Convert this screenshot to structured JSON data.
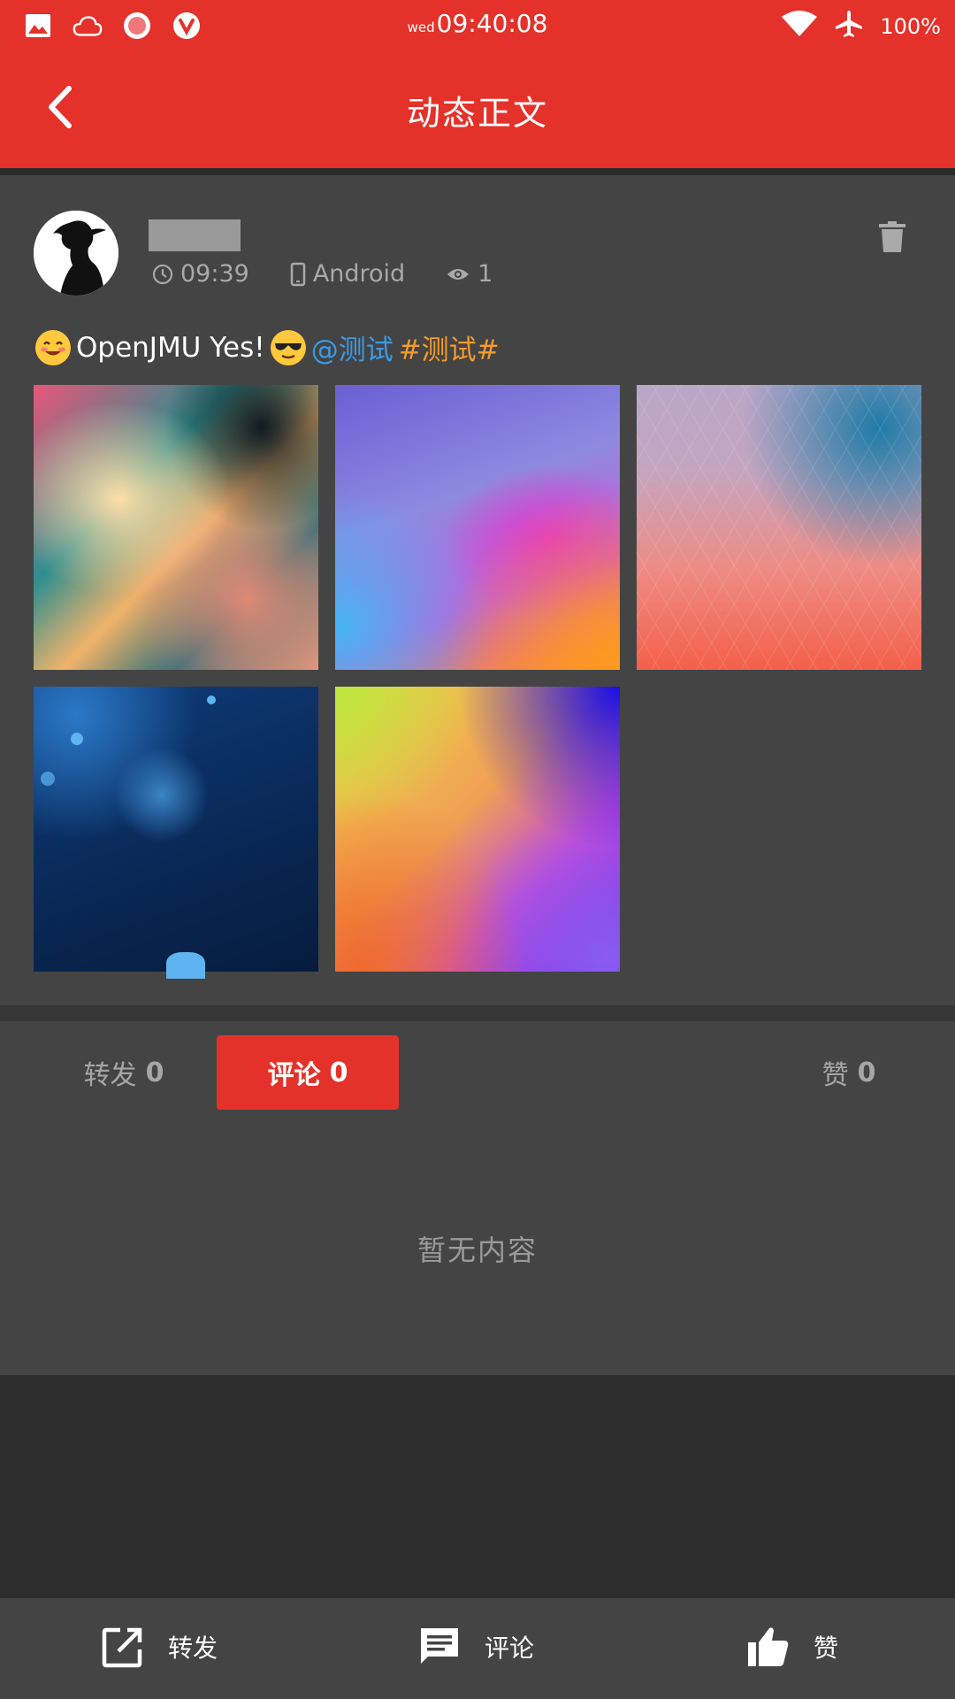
{
  "status_bar": {
    "day": "wed",
    "time": "09:40:08",
    "battery": "100%",
    "icons_left": [
      "image-icon",
      "cloud-icon",
      "record-icon",
      "vivaldi-icon"
    ],
    "icons_right": [
      "wifi-icon",
      "airplane-icon"
    ]
  },
  "app_bar": {
    "title": "动态正文"
  },
  "post": {
    "time": "09:39",
    "device": "Android",
    "views": "1",
    "text_main": "OpenJMU Yes!",
    "mention": "@测试",
    "topic": "#测试#",
    "images": [
      "abstract-swirl",
      "purple-orange-wave",
      "triangle-pattern",
      "blue-bokeh",
      "colorful-gradient"
    ]
  },
  "tabs": {
    "forward_label": "转发",
    "forward_count": "0",
    "comment_label": "评论",
    "comment_count": "0",
    "like_label": "赞",
    "like_count": "0",
    "selected": "comment"
  },
  "comments": {
    "empty_text": "暂无内容"
  },
  "bottom_bar": {
    "forward": "转发",
    "comment": "评论",
    "like": "赞"
  },
  "colors": {
    "accent": "#e4322b",
    "background": "#2d2d2d",
    "card": "#444444",
    "mention": "#3b9be5",
    "topic": "#f39c2b"
  }
}
